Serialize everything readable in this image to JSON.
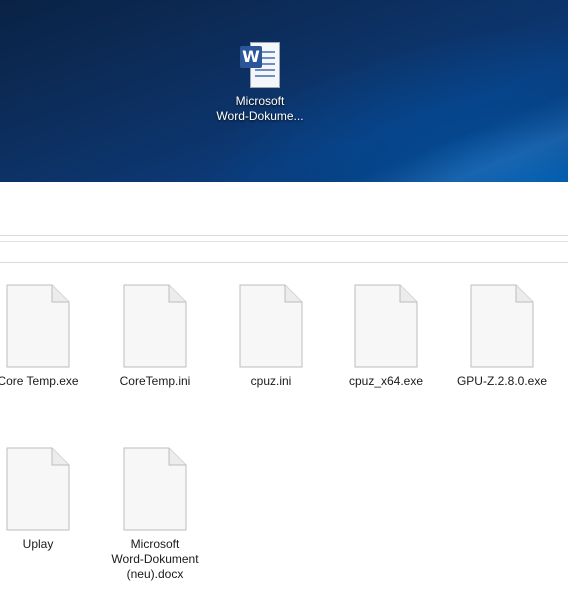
{
  "desktop": {
    "icon": {
      "icon_name": "word-document-icon",
      "badge_letter": "W",
      "label_line1": "Microsoft",
      "label_line2": "Word-Dokume..."
    }
  },
  "explorer": {
    "files": [
      {
        "label": "Core Temp.exe",
        "icon_name": "blank-file-icon"
      },
      {
        "label": "CoreTemp.ini",
        "icon_name": "blank-file-icon"
      },
      {
        "label": "cpuz.ini",
        "icon_name": "blank-file-icon"
      },
      {
        "label": "cpuz_x64.exe",
        "icon_name": "blank-file-icon"
      },
      {
        "label": "GPU-Z.2.8.0.exe",
        "icon_name": "blank-file-icon"
      },
      {
        "label": "Uplay",
        "icon_name": "blank-file-icon"
      },
      {
        "label_line1": "Microsoft",
        "label_line2": "Word-Dokument",
        "label_line3": "(neu).docx",
        "icon_name": "blank-file-icon"
      }
    ]
  },
  "colors": {
    "desktop_dark": "#0a2244",
    "desktop_light": "#0078d7",
    "word_blue": "#2b579a"
  }
}
